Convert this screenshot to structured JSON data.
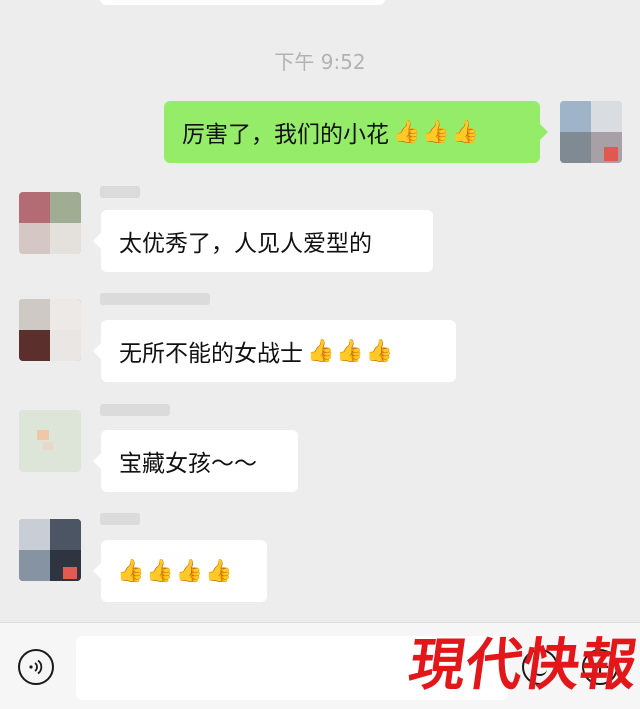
{
  "chat": {
    "timestamp": "下午 9:52",
    "messages": [
      {
        "id": "m1",
        "direction": "outgoing",
        "text": "厉害了，我们的小花",
        "emoji": "👍👍👍"
      },
      {
        "id": "m2",
        "direction": "incoming",
        "text": "太优秀了，人见人爱型的",
        "emoji": ""
      },
      {
        "id": "m3",
        "direction": "incoming",
        "text": "无所不能的女战士",
        "emoji": "👍👍👍"
      },
      {
        "id": "m4",
        "direction": "incoming",
        "text": "宝藏女孩～～",
        "emoji": ""
      },
      {
        "id": "m5",
        "direction": "incoming",
        "text": "",
        "emoji": "👍👍👍👍"
      }
    ]
  },
  "input_bar": {
    "voice_icon": "voice-icon",
    "emoji_icon": "emoji-icon",
    "plus_icon": "plus-icon",
    "value": ""
  },
  "watermark": {
    "text": "現代快報",
    "color": "#e3161a"
  },
  "colors": {
    "background": "#ededed",
    "outgoing_bubble": "#95ec69",
    "incoming_bubble": "#ffffff"
  }
}
